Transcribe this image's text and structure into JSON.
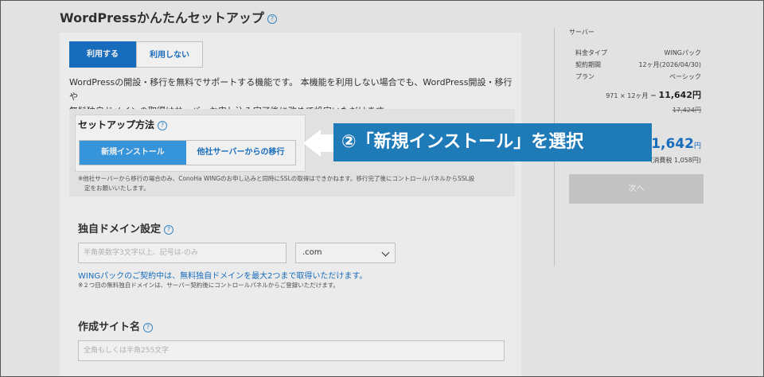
{
  "header": {
    "title": "WordPressかんたんセットアップ"
  },
  "tabs": [
    {
      "label": "利用する"
    },
    {
      "label": "利用しない"
    }
  ],
  "description": {
    "line1": "WordPressの開設・移行を無料でサポートする機能です。 本機能を利用しない場合でも、WordPress開設・移行や",
    "line2": "無料独自ドメインの取得はサーバーお申し込み完了後に改めて設定いただけます。"
  },
  "setup": {
    "title": "セットアップ方法",
    "options": [
      {
        "label": "新規インストール"
      },
      {
        "label": "他社サーバーからの移行"
      }
    ],
    "note1": "※他社サーバーから移行の場合のみ、ConoHa WINGのお申し込みと同時にSSLの取得はできかねます。移行完了後にコントロールパネルからSSL設",
    "note2": "定をお願いいたします。"
  },
  "domain": {
    "title": "独自ドメイン設定",
    "placeholder": "半角英数字3文字以上、記号は-のみ",
    "tld": ".com",
    "blue_note": "WINGパックのご契約中は、無料独自ドメインを最大2つまで取得いただけます。",
    "small_note": "※２つ目の無料独自ドメインは、サーバー契約後にコントロールパネルからご登録いただけます。"
  },
  "site": {
    "title": "作成サイト名",
    "placeholder": "全角もしくは半角255文字"
  },
  "sidebar": {
    "heading": "サーバー",
    "rows": [
      {
        "label": "料金タイプ",
        "value": "WINGパック"
      },
      {
        "label": "契約期間",
        "value": "12ヶ月(2026/04/30)"
      },
      {
        "label": "プラン",
        "value": "ベーシック"
      }
    ],
    "calc_prefix": "971 × 12ヶ月 ＝",
    "calc_total": "11,642円",
    "strike_price": "17,424円",
    "total_amount": "11,642",
    "total_unit": "円",
    "tax_note": "(消費税 1,058円)",
    "next_button": "次へ"
  },
  "annotation": {
    "text": "②「新規インストール」を選択"
  }
}
